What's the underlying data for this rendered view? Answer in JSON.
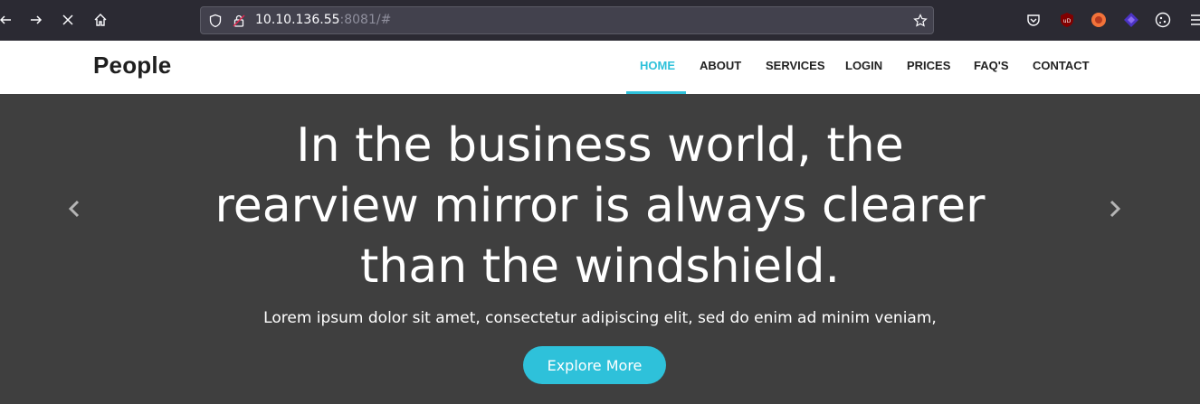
{
  "browser": {
    "url_host": "10.10.136.55",
    "url_rest": ":8081/#",
    "back_icon": "arrow-left-icon",
    "forward_icon": "arrow-right-icon",
    "stop_icon": "close-icon",
    "home_icon": "home-icon"
  },
  "site": {
    "brand": "People",
    "nav": [
      "HOME",
      "ABOUT",
      "SERVICES",
      "LOGIN",
      "PRICES",
      "FAQ'S",
      "CONTACT"
    ],
    "active_nav": "HOME",
    "accent": "#2ec1da"
  },
  "hero": {
    "headline_line1": "In the business world, the",
    "headline_line2": "rearview mirror is always clearer",
    "headline_line3": "than the windshield.",
    "subtext": "Lorem ipsum dolor sit amet, consectetur adipiscing elit, sed do enim ad minim veniam,",
    "cta": "Explore More"
  }
}
